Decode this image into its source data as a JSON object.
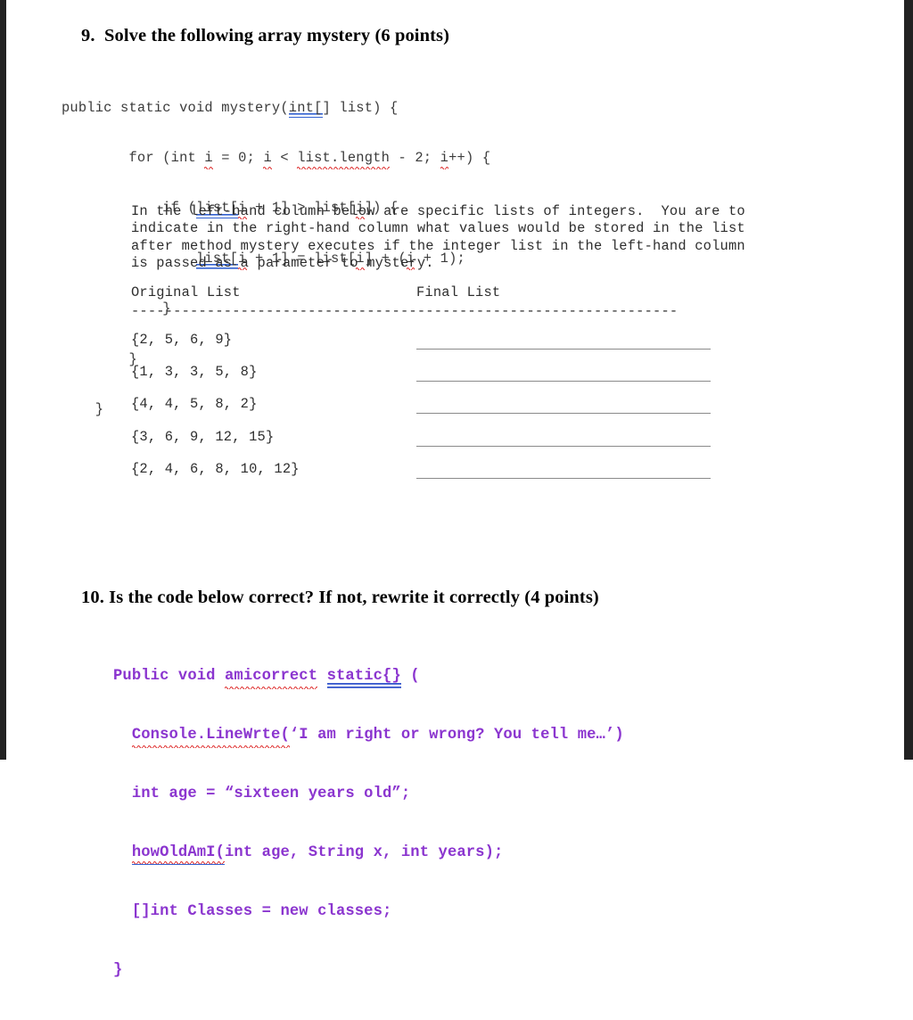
{
  "document": {
    "questions": [
      {
        "number": "9.",
        "title": "Solve the following array mystery (6 points)"
      },
      {
        "number": "10.",
        "title": "Is the code below correct? If not, rewrite it correctly (4 points)"
      }
    ]
  },
  "mystery_code": {
    "line1_a": "public static void mystery(",
    "line1_b": "int[",
    "line1_c": "] list) {",
    "line2_a": "        for (int ",
    "line2_b": "i",
    "line2_c": " = 0; ",
    "line2_d": "i",
    "line2_e": " < ",
    "line2_f": "list.length",
    "line2_g": " - 2; ",
    "line2_h": "i",
    "line2_i": "++) {",
    "line3_a": "            if (",
    "line3_b": "list[",
    "line3_c": "i",
    "line3_d": " + 1] > list[",
    "line3_e": "i",
    "line3_f": "]) {",
    "line4_a": "                ",
    "line4_b": "list[",
    "line4_c": "i",
    "line4_d": " + 1] = list[",
    "line4_e": "i",
    "line4_f": "] + (",
    "line4_g": "i",
    "line4_h": " + 1);",
    "line5": "            }",
    "line6": "        }",
    "line7": "    }"
  },
  "instructions": {
    "line1": "In the left-hand column below are specific lists of integers.  You are to",
    "line2": "indicate in the right-hand column what values would be stored in the list",
    "line3": "after method mystery executes if the integer list in the left-hand column",
    "line4": "is passed as a parameter to mystery."
  },
  "table": {
    "header_left": "Original List",
    "header_right": "Final List",
    "separator": "-----------------------------------------------------------------",
    "rows": [
      {
        "original": "{2, 5, 6, 9}",
        "final": ""
      },
      {
        "original": "{1, 3, 3, 5, 8}",
        "final": ""
      },
      {
        "original": "{4, 4, 5, 8, 2}",
        "final": ""
      },
      {
        "original": "{3, 6, 9, 12, 15}",
        "final": ""
      },
      {
        "original": "{2, 4, 6, 8, 10, 12}",
        "final": ""
      }
    ]
  },
  "buggy_code": {
    "line1_a": "Public void ",
    "line1_b": "amicorrect",
    "line1_c": " ",
    "line1_d": "static{}",
    "line1_e": " (",
    "line2_a": "  ",
    "line2_b": "Console.LineWrte(",
    "line2_c": "‘I am right or wrong? You tell me…’)",
    "line3": "  int age = “sixteen years old”;",
    "line4_a": "  ",
    "line4_b": "howOldAmI(",
    "line4_c": "int age, String x, int years);",
    "line5": "  []int Classes = new classes;",
    "line6": "}"
  },
  "colors": {
    "purple_code": "#8b35cf",
    "mono_code": "#3b3b3b",
    "spell_error": "#dd2222",
    "grammar_error": "#2f5fd0",
    "answer_line": "#8a8a8a",
    "page_border": "#222222"
  }
}
